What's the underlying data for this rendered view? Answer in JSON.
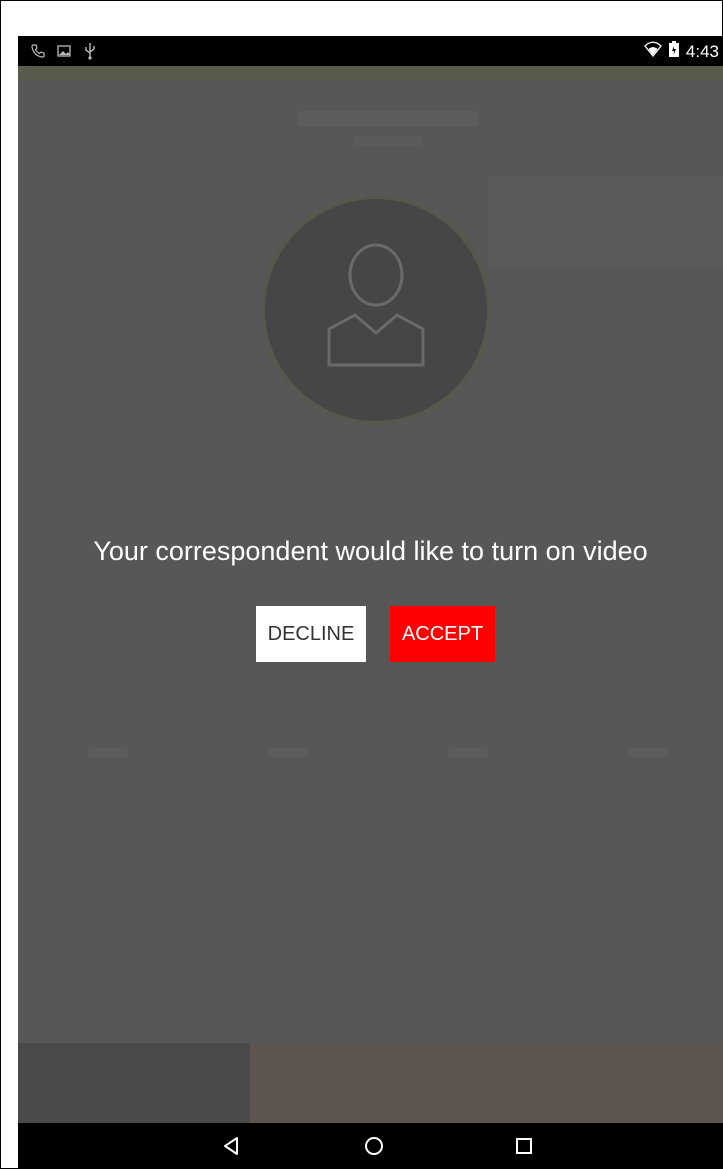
{
  "status_bar": {
    "left_icons": [
      "phone-icon",
      "image-icon",
      "usb-icon"
    ],
    "right_icons": [
      "wifi-icon",
      "battery-icon"
    ],
    "time": "4:43"
  },
  "dialog": {
    "message": "Your correspondent would like to turn on video",
    "decline_label": "DECLINE",
    "accept_label": "ACCEPT"
  },
  "colors": {
    "accept": "#ff0000",
    "decline": "#ffffff",
    "overlay": "#575757"
  },
  "nav_bar": {
    "buttons": [
      "back-icon",
      "home-icon",
      "recents-icon"
    ]
  }
}
